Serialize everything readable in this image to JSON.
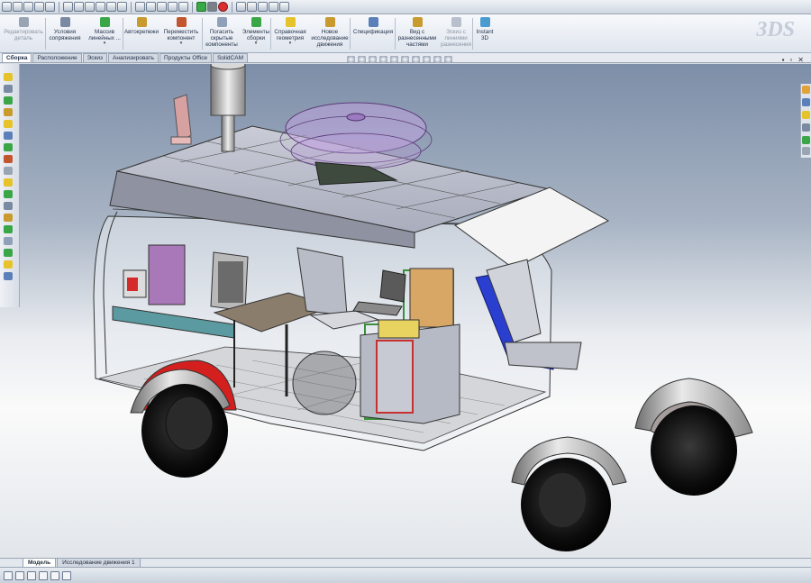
{
  "colors": {
    "accent": "#2b4c8c",
    "ribbon_bg": "#e8edf4"
  },
  "quickbar": {
    "icons": [
      "new-icon",
      "open-icon",
      "save-icon",
      "print-icon",
      "undo-icon",
      "select-icon",
      "rebuild-icon",
      "options-icon",
      "sketch-icon",
      "measure-icon",
      "mass-icon",
      "sum-icon",
      "display-icon",
      "zoom-icon",
      "ellipse-icon",
      "cube-icon",
      "play-icon",
      "stop-icon",
      "record-icon",
      "cube-icon",
      "edit-icon",
      "view-icon",
      "settings-icon",
      "help-icon"
    ]
  },
  "ribbon": {
    "buttons": [
      {
        "name": "edit-component-button",
        "label": "Редактировать\nдеталь",
        "disabled": true,
        "color": "#9aa5b4"
      },
      {
        "name": "mate-button",
        "label": "Условия\nсопряжения",
        "color": "#7a8aa3"
      },
      {
        "name": "linear-pattern-button",
        "label": "Массив\nлинейных ...",
        "color": "#3aa648",
        "arrow": "▾"
      },
      {
        "name": "smart-fasteners-button",
        "label": "Автокрепежи",
        "color": "#c99a2e"
      },
      {
        "name": "move-component-button",
        "label": "Переместить\nкомпонент",
        "color": "#c2562e",
        "arrow": "▾"
      },
      {
        "name": "show-hidden-button",
        "label": "Погасить\nскрытые\nкомпоненты",
        "color": "#8fa0b8"
      },
      {
        "name": "assembly-features-button",
        "label": "Элементы\nсборки",
        "color": "#3aa648",
        "arrow": "▾"
      },
      {
        "name": "reference-geometry-button",
        "label": "Справочная\nгеометрия",
        "color": "#e6c32a",
        "arrow": "▾"
      },
      {
        "name": "new-motion-study-button",
        "label": "Новое\nисследование\nдвижения",
        "color": "#c99a2e"
      },
      {
        "name": "bom-button",
        "label": "Спецификация",
        "color": "#5b7fb8"
      },
      {
        "name": "exploded-view-button",
        "label": "Вид с\nразнесенными\nчастями",
        "color": "#c99a2e"
      },
      {
        "name": "explode-line-button",
        "label": "Эскиз с\nлиниями\nразнесения",
        "disabled": true,
        "color": "#b8c0cc"
      },
      {
        "name": "instant3d-button",
        "label": "Instant\n3D",
        "color": "#4b9bd1"
      }
    ]
  },
  "tabs": [
    "Сборка",
    "Расположение",
    "Эскиз",
    "Анализировать",
    "Продукты Office",
    "SolidCAM"
  ],
  "active_tab": "Сборка",
  "bottom_tabs": [
    "Модель",
    "Исследование движения 1"
  ],
  "active_bottom_tab": "Модель",
  "window_controls": {
    "minimize": "▪",
    "restore": "▫",
    "close": "✕"
  },
  "logo": "3DS"
}
